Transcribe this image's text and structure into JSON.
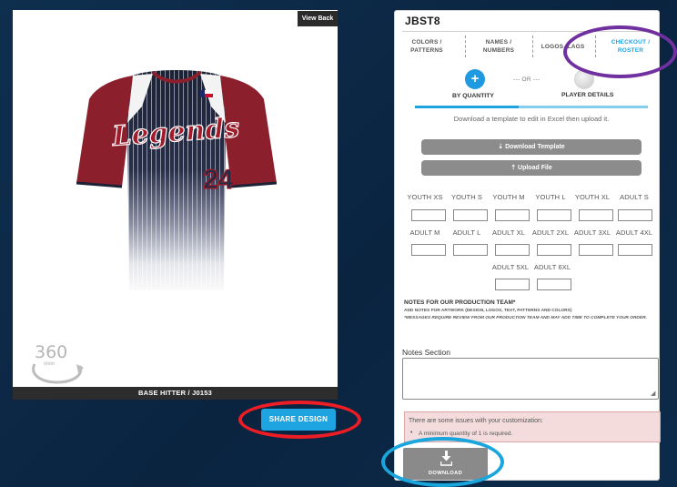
{
  "product": {
    "view_back": "View Back",
    "caption": "BASE HITTER / J0153",
    "jersey_script": "Legends",
    "jersey_number": "24",
    "view360_big": "360",
    "view360_small": "view"
  },
  "share_button": "SHARE DESIGN",
  "customizer": {
    "design_code": "JBST8",
    "tabs": [
      {
        "line1": "COLORS /",
        "line2": "PATTERNS"
      },
      {
        "line1": "NAMES /",
        "line2": "NUMBERS"
      },
      {
        "label": "LOGOS"
      },
      {
        "label": "LAGS"
      },
      {
        "line1": "CHECKOUT /",
        "line2": "ROSTER"
      }
    ],
    "qty_icon": "+",
    "or_text": "--- OR ---",
    "by_quantity": "BY QUANTITY",
    "player_details": "PLAYER DETAILS",
    "template_text": "Download a template to edit in Excel then upload it.",
    "download_template": "⇣ Download Template",
    "upload_file": "⇡ Upload File",
    "sizes_row1": [
      "YOUTH XS",
      "YOUTH S",
      "YOUTH M",
      "YOUTH L",
      "YOUTH XL",
      "ADULT S"
    ],
    "sizes_row2": [
      "ADULT M",
      "ADULT L",
      "ADULT XL",
      "ADULT 2XL",
      "ADULT 3XL",
      "ADULT 4XL"
    ],
    "sizes_row3": [
      "ADULT 5XL",
      "ADULT 6XL"
    ],
    "notes_heading": "NOTES FOR OUR PRODUCTION TEAM*",
    "notes_sub": "ADD NOTES FOR ARTWORK (DESIGN, LOGOS, TEXT, PATTERNS AND COLORS)",
    "notes_msg": "*MESSAGES REQUIRE REVIEW FROM OUR PRODUCTION TEAM AND MAY ADD TIME TO COMPLETE YOUR ORDER.",
    "notes_label": "Notes Section",
    "issue_title": "There are some issues with your customization:",
    "issue_bullet": "•",
    "issue_item": "A minimum quantity of 1 is required.",
    "download": "DOWNLOAD"
  },
  "colors": {
    "accent": "#1ea4e0",
    "highlight_red": "#ec1d24",
    "highlight_purple": "#7030a0",
    "highlight_blue": "#1aa6dc"
  },
  "icons": [
    "360-view-icon",
    "download-icon",
    "plus-icon",
    "texas-flag-icon"
  ]
}
